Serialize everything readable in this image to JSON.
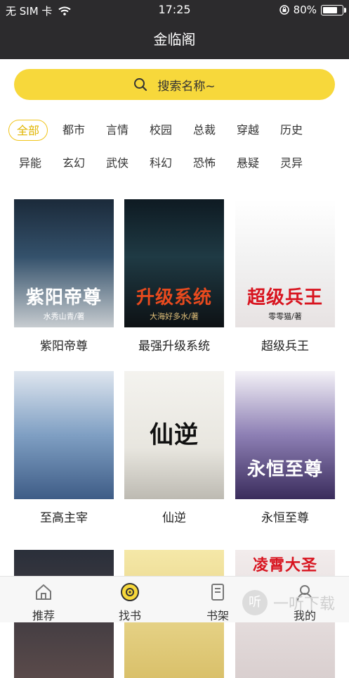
{
  "status": {
    "carrier": "无 SIM 卡",
    "time": "17:25",
    "battery": "80%",
    "battery_level": 0.8
  },
  "header": {
    "title": "金临阁"
  },
  "search": {
    "placeholder": "搜索名称~"
  },
  "categories_row1": [
    "全部",
    "都市",
    "言情",
    "校园",
    "总裁",
    "穿越",
    "历史"
  ],
  "categories_row2": [
    "异能",
    "玄幻",
    "武侠",
    "科幻",
    "恐怖",
    "悬疑",
    "灵异"
  ],
  "books": [
    {
      "title": "紫阳帝尊",
      "cover_text": "紫阳帝尊",
      "cover_sub": "水秀山青/著"
    },
    {
      "title": "最强升级系统",
      "cover_text": "升级系统",
      "cover_sub": "大海好多水/著"
    },
    {
      "title": "超级兵王",
      "cover_text": "超级兵王",
      "cover_sub": "零零猫/著"
    },
    {
      "title": "至高主宰",
      "cover_text": "",
      "cover_sub": ""
    },
    {
      "title": "仙逆",
      "cover_text": "仙逆",
      "cover_sub": ""
    },
    {
      "title": "永恒至尊",
      "cover_text": "永恒至尊",
      "cover_sub": ""
    },
    {
      "title": "",
      "cover_text": "",
      "cover_sub": ""
    },
    {
      "title": "",
      "cover_text": "",
      "cover_sub": ""
    },
    {
      "title": "",
      "cover_text": "凌霄大圣",
      "cover_sub": ""
    }
  ],
  "tabs": [
    {
      "label": "推荐",
      "icon": "home-icon"
    },
    {
      "label": "找书",
      "icon": "find-book-icon"
    },
    {
      "label": "书架",
      "icon": "bookshelf-icon"
    },
    {
      "label": "我的",
      "icon": "profile-icon"
    }
  ],
  "watermark": {
    "text": "一听下载",
    "glyph": "听"
  },
  "colors": {
    "accent": "#f7d83b",
    "header_bg": "#2c2b2d",
    "active_text": "#e0b500"
  }
}
